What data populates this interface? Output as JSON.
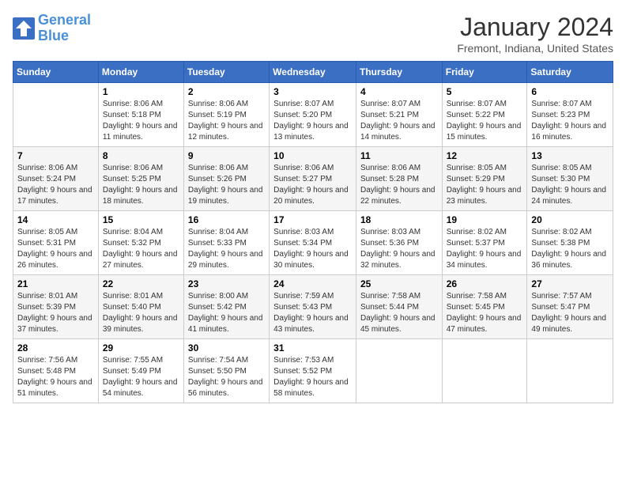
{
  "header": {
    "logo_general": "General",
    "logo_blue": "Blue",
    "month_title": "January 2024",
    "location": "Fremont, Indiana, United States"
  },
  "weekdays": [
    "Sunday",
    "Monday",
    "Tuesday",
    "Wednesday",
    "Thursday",
    "Friday",
    "Saturday"
  ],
  "weeks": [
    [
      {
        "day": "",
        "sunrise": "",
        "sunset": "",
        "daylight": ""
      },
      {
        "day": "1",
        "sunrise": "Sunrise: 8:06 AM",
        "sunset": "Sunset: 5:18 PM",
        "daylight": "Daylight: 9 hours and 11 minutes."
      },
      {
        "day": "2",
        "sunrise": "Sunrise: 8:06 AM",
        "sunset": "Sunset: 5:19 PM",
        "daylight": "Daylight: 9 hours and 12 minutes."
      },
      {
        "day": "3",
        "sunrise": "Sunrise: 8:07 AM",
        "sunset": "Sunset: 5:20 PM",
        "daylight": "Daylight: 9 hours and 13 minutes."
      },
      {
        "day": "4",
        "sunrise": "Sunrise: 8:07 AM",
        "sunset": "Sunset: 5:21 PM",
        "daylight": "Daylight: 9 hours and 14 minutes."
      },
      {
        "day": "5",
        "sunrise": "Sunrise: 8:07 AM",
        "sunset": "Sunset: 5:22 PM",
        "daylight": "Daylight: 9 hours and 15 minutes."
      },
      {
        "day": "6",
        "sunrise": "Sunrise: 8:07 AM",
        "sunset": "Sunset: 5:23 PM",
        "daylight": "Daylight: 9 hours and 16 minutes."
      }
    ],
    [
      {
        "day": "7",
        "sunrise": "Sunrise: 8:06 AM",
        "sunset": "Sunset: 5:24 PM",
        "daylight": "Daylight: 9 hours and 17 minutes."
      },
      {
        "day": "8",
        "sunrise": "Sunrise: 8:06 AM",
        "sunset": "Sunset: 5:25 PM",
        "daylight": "Daylight: 9 hours and 18 minutes."
      },
      {
        "day": "9",
        "sunrise": "Sunrise: 8:06 AM",
        "sunset": "Sunset: 5:26 PM",
        "daylight": "Daylight: 9 hours and 19 minutes."
      },
      {
        "day": "10",
        "sunrise": "Sunrise: 8:06 AM",
        "sunset": "Sunset: 5:27 PM",
        "daylight": "Daylight: 9 hours and 20 minutes."
      },
      {
        "day": "11",
        "sunrise": "Sunrise: 8:06 AM",
        "sunset": "Sunset: 5:28 PM",
        "daylight": "Daylight: 9 hours and 22 minutes."
      },
      {
        "day": "12",
        "sunrise": "Sunrise: 8:05 AM",
        "sunset": "Sunset: 5:29 PM",
        "daylight": "Daylight: 9 hours and 23 minutes."
      },
      {
        "day": "13",
        "sunrise": "Sunrise: 8:05 AM",
        "sunset": "Sunset: 5:30 PM",
        "daylight": "Daylight: 9 hours and 24 minutes."
      }
    ],
    [
      {
        "day": "14",
        "sunrise": "Sunrise: 8:05 AM",
        "sunset": "Sunset: 5:31 PM",
        "daylight": "Daylight: 9 hours and 26 minutes."
      },
      {
        "day": "15",
        "sunrise": "Sunrise: 8:04 AM",
        "sunset": "Sunset: 5:32 PM",
        "daylight": "Daylight: 9 hours and 27 minutes."
      },
      {
        "day": "16",
        "sunrise": "Sunrise: 8:04 AM",
        "sunset": "Sunset: 5:33 PM",
        "daylight": "Daylight: 9 hours and 29 minutes."
      },
      {
        "day": "17",
        "sunrise": "Sunrise: 8:03 AM",
        "sunset": "Sunset: 5:34 PM",
        "daylight": "Daylight: 9 hours and 30 minutes."
      },
      {
        "day": "18",
        "sunrise": "Sunrise: 8:03 AM",
        "sunset": "Sunset: 5:36 PM",
        "daylight": "Daylight: 9 hours and 32 minutes."
      },
      {
        "day": "19",
        "sunrise": "Sunrise: 8:02 AM",
        "sunset": "Sunset: 5:37 PM",
        "daylight": "Daylight: 9 hours and 34 minutes."
      },
      {
        "day": "20",
        "sunrise": "Sunrise: 8:02 AM",
        "sunset": "Sunset: 5:38 PM",
        "daylight": "Daylight: 9 hours and 36 minutes."
      }
    ],
    [
      {
        "day": "21",
        "sunrise": "Sunrise: 8:01 AM",
        "sunset": "Sunset: 5:39 PM",
        "daylight": "Daylight: 9 hours and 37 minutes."
      },
      {
        "day": "22",
        "sunrise": "Sunrise: 8:01 AM",
        "sunset": "Sunset: 5:40 PM",
        "daylight": "Daylight: 9 hours and 39 minutes."
      },
      {
        "day": "23",
        "sunrise": "Sunrise: 8:00 AM",
        "sunset": "Sunset: 5:42 PM",
        "daylight": "Daylight: 9 hours and 41 minutes."
      },
      {
        "day": "24",
        "sunrise": "Sunrise: 7:59 AM",
        "sunset": "Sunset: 5:43 PM",
        "daylight": "Daylight: 9 hours and 43 minutes."
      },
      {
        "day": "25",
        "sunrise": "Sunrise: 7:58 AM",
        "sunset": "Sunset: 5:44 PM",
        "daylight": "Daylight: 9 hours and 45 minutes."
      },
      {
        "day": "26",
        "sunrise": "Sunrise: 7:58 AM",
        "sunset": "Sunset: 5:45 PM",
        "daylight": "Daylight: 9 hours and 47 minutes."
      },
      {
        "day": "27",
        "sunrise": "Sunrise: 7:57 AM",
        "sunset": "Sunset: 5:47 PM",
        "daylight": "Daylight: 9 hours and 49 minutes."
      }
    ],
    [
      {
        "day": "28",
        "sunrise": "Sunrise: 7:56 AM",
        "sunset": "Sunset: 5:48 PM",
        "daylight": "Daylight: 9 hours and 51 minutes."
      },
      {
        "day": "29",
        "sunrise": "Sunrise: 7:55 AM",
        "sunset": "Sunset: 5:49 PM",
        "daylight": "Daylight: 9 hours and 54 minutes."
      },
      {
        "day": "30",
        "sunrise": "Sunrise: 7:54 AM",
        "sunset": "Sunset: 5:50 PM",
        "daylight": "Daylight: 9 hours and 56 minutes."
      },
      {
        "day": "31",
        "sunrise": "Sunrise: 7:53 AM",
        "sunset": "Sunset: 5:52 PM",
        "daylight": "Daylight: 9 hours and 58 minutes."
      },
      {
        "day": "",
        "sunrise": "",
        "sunset": "",
        "daylight": ""
      },
      {
        "day": "",
        "sunrise": "",
        "sunset": "",
        "daylight": ""
      },
      {
        "day": "",
        "sunrise": "",
        "sunset": "",
        "daylight": ""
      }
    ]
  ]
}
